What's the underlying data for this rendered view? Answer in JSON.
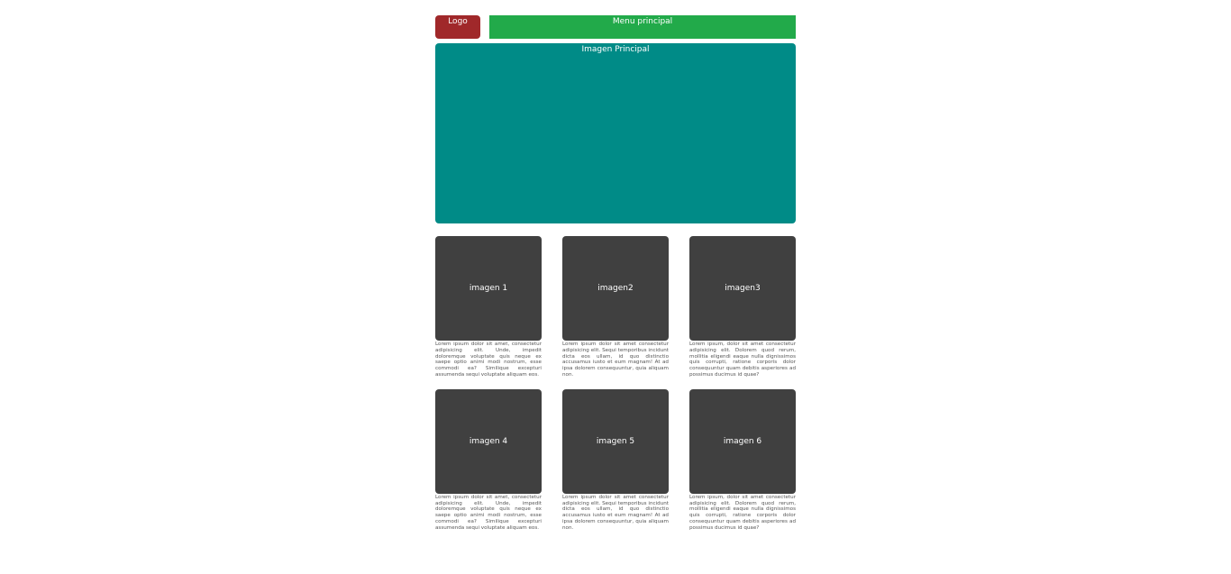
{
  "header": {
    "logo_label": "Logo",
    "menu_label": "Menu principal"
  },
  "hero": {
    "label": "Imagen Principal"
  },
  "colors": {
    "logo": "#a0282a",
    "menu": "#22aa4a",
    "hero": "#008b87",
    "thumb": "#404040"
  },
  "cards": [
    {
      "label": "imagen 1",
      "text": "Lorem ipsum dolor sit amet, consectetur adipisicing elit. Unde, impedit doloremque voluptate quis neque ex saepe optio animi modi nostrum, esse commodi ea? Similique excepturi assumenda sequi voluptate aliquam eos."
    },
    {
      "label": "imagen2",
      "text": "Lorem ipsum dolor sit amet consectetur adipisicing elit. Sequi temporibus incidunt dicta eos ullam, id quo distinctio accusamus iusto et eum magnam! At ad ipsa dolorem consequuntur, quia aliquam non."
    },
    {
      "label": "imagen3",
      "text": "Lorem ipsum, dolor sit amet consectetur adipisicing elit. Dolorem quod rerum, mollitia eligendi eaque nulla dignissimos quis corrupti, ratione corporis dolor consequuntur quam debitis asperiores ad possimus ducimus id quae?"
    },
    {
      "label": "imagen 4",
      "text": "Lorem ipsum dolor sit amet, consectetur adipisicing elit. Unde, impedit doloremque voluptate quis neque ex saepe optio animi modi nostrum, esse commodi ea? Similique excepturi assumenda sequi voluptate aliquam eos."
    },
    {
      "label": "imagen 5",
      "text": "Lorem ipsum dolor sit amet consectetur adipisicing elit. Sequi temporibus incidunt dicta eos ullam, id quo distinctio accusamus iusto et eum magnam! At ad ipsa dolorem consequuntur, quia aliquam non."
    },
    {
      "label": "imagen 6",
      "text": "Lorem ipsum, dolor sit amet consectetur adipisicing elit. Dolorem quod rerum, mollitia eligendi eaque nulla dignissimos quis corrupti, ratione corporis dolor consequuntur quam debitis asperiores ad possimus ducimus id quae?"
    }
  ]
}
